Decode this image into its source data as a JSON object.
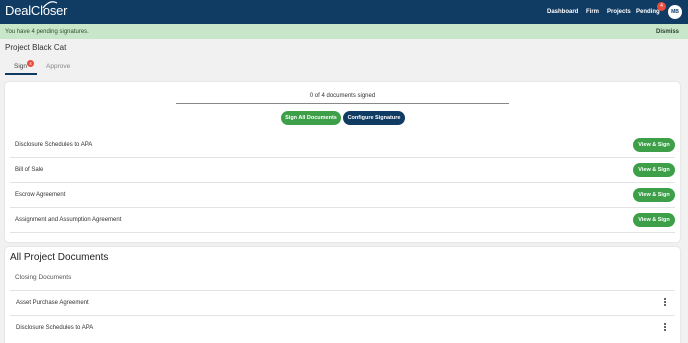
{
  "navbar": {
    "logo_text": "DealCloser",
    "links": [
      "Dashboard",
      "Firm",
      "Projects",
      "Pending"
    ],
    "pending_count": "4",
    "avatar_initials": "MB",
    "bg_color": "#103b63"
  },
  "alert": {
    "message": "You have 4 pending signatures.",
    "dismiss_label": "Dismiss",
    "bg_color": "#c8e6c9"
  },
  "project": {
    "title": "Project Black Cat"
  },
  "tabs": {
    "sign_label": "Sign",
    "sign_badge": "4",
    "approve_label": "Approve",
    "active": "Sign"
  },
  "signing": {
    "progress_text": "0 of 4 documents signed",
    "signed": 0,
    "total": 4,
    "sign_all_label": "Sign All Documents",
    "configure_label": "Configure Signature",
    "view_sign_label": "View & Sign",
    "documents": [
      "Disclosure Schedules to APA",
      "Bill of Sale",
      "Escrow Agreement",
      "Assignment and Assumption Agreement"
    ],
    "button_color": "#3da049"
  },
  "project_documents": {
    "title": "All Project Documents",
    "group_title": "Closing Documents",
    "documents": [
      "Asset Purchase Agreement",
      "Disclosure Schedules to APA"
    ],
    "menu_icon": "more-vertical-icon"
  }
}
